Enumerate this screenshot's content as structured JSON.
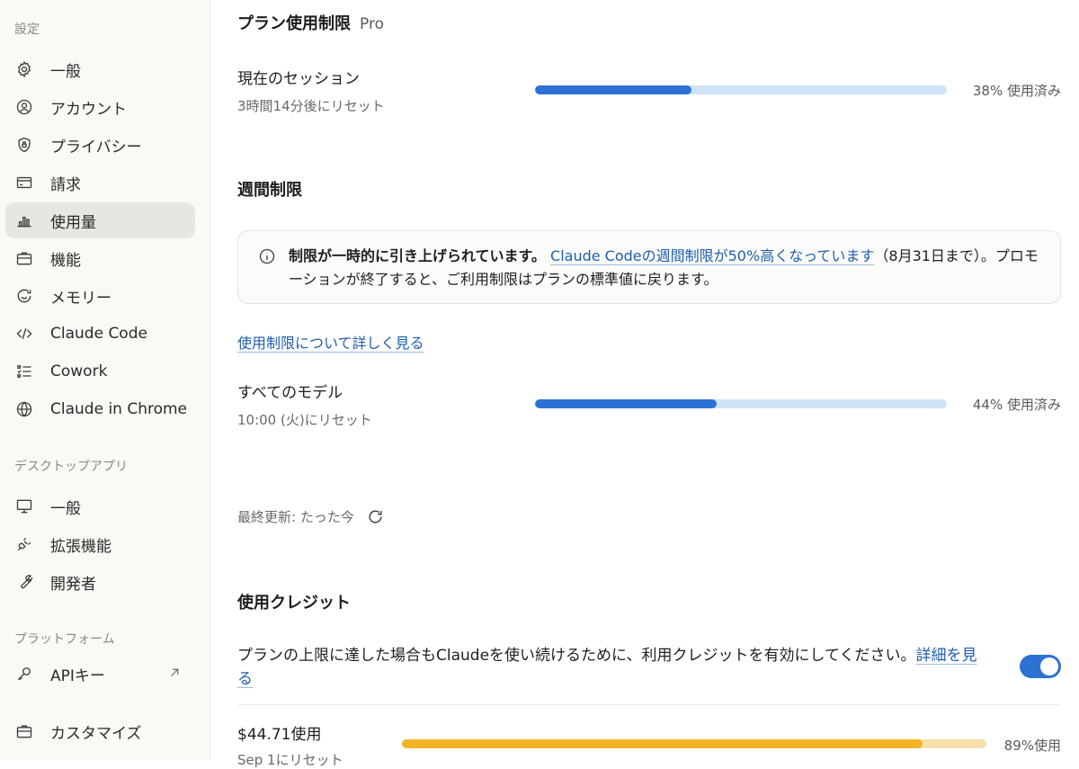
{
  "sidebar": {
    "section_settings": "設定",
    "settings_items": [
      {
        "label": "一般",
        "icon": "gear-icon"
      },
      {
        "label": "アカウント",
        "icon": "user-circle-icon"
      },
      {
        "label": "プライバシー",
        "icon": "shield-lock-icon"
      },
      {
        "label": "請求",
        "icon": "credit-card-icon"
      },
      {
        "label": "使用量",
        "icon": "bar-chart-icon",
        "active": true
      },
      {
        "label": "機能",
        "icon": "briefcase-icon"
      },
      {
        "label": "メモリー",
        "icon": "memory-icon"
      },
      {
        "label": "Claude Code",
        "icon": "code-icon"
      },
      {
        "label": "Cowork",
        "icon": "checklist-icon"
      },
      {
        "label": "Claude in Chrome",
        "icon": "globe-icon"
      }
    ],
    "section_desktop": "デスクトップアプリ",
    "desktop_items": [
      {
        "label": "一般",
        "icon": "monitor-icon"
      },
      {
        "label": "拡張機能",
        "icon": "plug-icon"
      },
      {
        "label": "開発者",
        "icon": "wrench-icon"
      }
    ],
    "section_platform": "プラットフォーム",
    "platform_items": [
      {
        "label": "APIキー",
        "icon": "key-icon",
        "external_icon": "arrow-up-right-icon"
      }
    ],
    "bottom_items": [
      {
        "label": "カスタマイズ",
        "icon": "briefcase-icon"
      }
    ]
  },
  "plan": {
    "title": "プラン使用制限",
    "plan_name": "Pro",
    "session": {
      "title": "現在のセッション",
      "reset": "3時間14分後にリセット",
      "percent_label": "38% 使用済み",
      "fraction": 0.38
    }
  },
  "weekly": {
    "title": "週間制限",
    "notice": {
      "bold": "制限が一時的に引き上げられています。",
      "link": "Claude Codeの週間制限が50%高くなっています",
      "rest": "（8月31日まで）。プロモーションが終了すると、ご利用制限はプランの標準値に戻ります。"
    },
    "learn_more": "使用制限について詳しく見る",
    "all_models": {
      "title": "すべてのモデル",
      "reset": "10:00 (火)にリセット",
      "percent_label": "44% 使用済み",
      "fraction": 0.44
    }
  },
  "last_updated": "最終更新: たった今",
  "credits": {
    "title": "使用クレジット",
    "description": "プランの上限に達した場合もClaudeを使い続けるために、利用クレジットを有効にしてください。",
    "details_link": "詳細を見る",
    "toggle_on": true,
    "usage": {
      "title": "$44.71使用",
      "reset": "Sep 1にリセット",
      "percent_label": "89%使用",
      "fraction": 0.89
    }
  },
  "colors": {
    "accent": "#2d72d2",
    "bar_track": "#cfe2f8",
    "credit_fill": "#f2b325",
    "credit_track": "#f7dfa9"
  }
}
